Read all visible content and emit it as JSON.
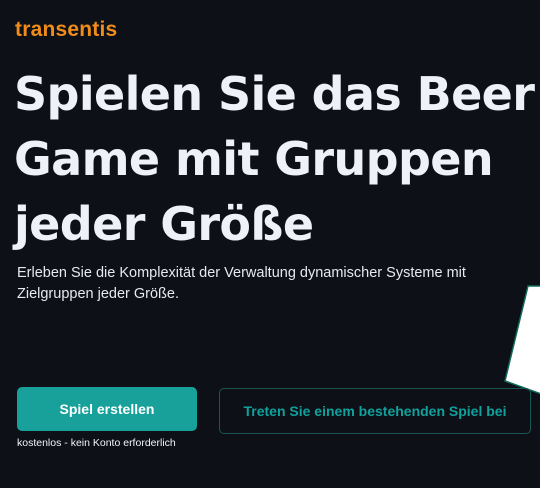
{
  "brand": {
    "name": "transentis",
    "color": "#f08c1a"
  },
  "hero": {
    "title_lines": [
      "Spielen Sie das Beer",
      "Game mit Gruppen",
      "jeder Größe"
    ],
    "subtitle": "Erleben Sie die Komplexität der Verwaltung dynamischer Systeme mit Zielgruppen jeder Größe."
  },
  "actions": {
    "create_game_label": "Spiel erstellen",
    "create_game_note": "kostenlos - kein Konto erforderlich",
    "join_game_label": "Treten Sie einem bestehenden Spiel bei"
  },
  "colors": {
    "background": "#0d1117",
    "accent": "#17a19a",
    "text": "#eef1f6"
  }
}
